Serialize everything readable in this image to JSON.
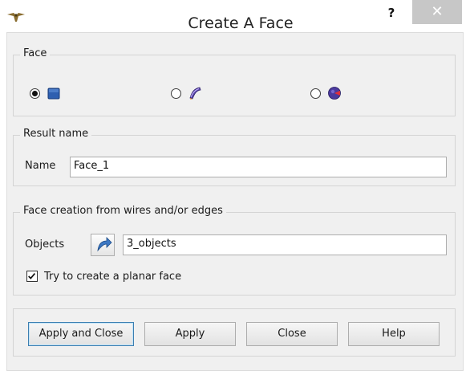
{
  "window": {
    "title": "Create A Face",
    "help_label": "?",
    "close_label": "✕"
  },
  "face_group": {
    "title": "Face",
    "options": [
      {
        "icon": "blue-square-face-icon",
        "checked": true
      },
      {
        "icon": "curved-surface-icon",
        "checked": false
      },
      {
        "icon": "cone-face-icon",
        "checked": false
      }
    ]
  },
  "result_group": {
    "title": "Result name",
    "name_label": "Name",
    "name_value": "Face_1"
  },
  "creation_group": {
    "title": "Face creation from wires and/or edges",
    "objects_label": "Objects",
    "objects_value": "3_objects",
    "planar_checkbox_label": "Try to create a planar face",
    "planar_checked": true
  },
  "buttons": {
    "apply_close": "Apply and Close",
    "apply": "Apply",
    "close": "Close",
    "help": "Help"
  },
  "colors": {
    "close_button": "#c7c7c7",
    "accent_blue": "#2e64b8"
  }
}
